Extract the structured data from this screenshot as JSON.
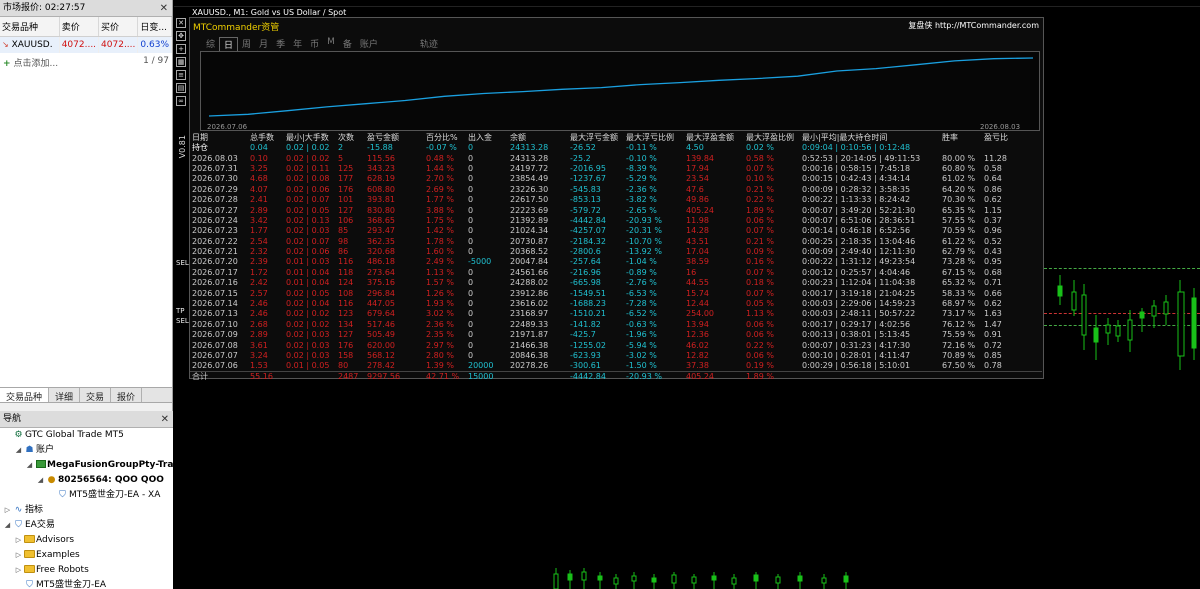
{
  "market_watch": {
    "title": "市场报价: 02:27:57",
    "columns": [
      "交易品种",
      "卖价",
      "买价",
      "日变..."
    ],
    "symbol": {
      "name": "XAUUSD.",
      "bid": "4072....",
      "ask": "4072....",
      "change": "0.63%"
    },
    "add_label": "点击添加...",
    "count": "1 / 97",
    "tabs": [
      "交易品种",
      "详细",
      "交易",
      "报价"
    ]
  },
  "navigator": {
    "title": "导航",
    "items": [
      {
        "label": "GTC Global Trade MT5",
        "level": 0,
        "icon": "gtc-icon",
        "bold": false
      },
      {
        "label": "账户",
        "level": 1,
        "icon": "accounts-icon",
        "bold": false
      },
      {
        "label": "MegaFusionGroupPty-Trad",
        "level": 2,
        "icon": "server-icon",
        "bold": true
      },
      {
        "label": "80256564: QOO QOO",
        "level": 3,
        "icon": "user-icon",
        "bold": true
      },
      {
        "label": "MT5盛世金刀-EA - XA",
        "level": 4,
        "icon": "ea-icon",
        "bold": false
      },
      {
        "label": "指标",
        "level": 0,
        "icon": "indicators-icon",
        "bold": false
      },
      {
        "label": "EA交易",
        "level": 0,
        "icon": "ea-icon",
        "bold": false
      },
      {
        "label": "Advisors",
        "level": 1,
        "icon": "folder-icon",
        "bold": false
      },
      {
        "label": "Examples",
        "level": 1,
        "icon": "folder-icon",
        "bold": false
      },
      {
        "label": "Free Robots",
        "level": 1,
        "icon": "folder-icon",
        "bold": false
      },
      {
        "label": "MT5盛世金刀-EA",
        "level": 1,
        "icon": "ea-icon",
        "bold": false
      }
    ]
  },
  "chart": {
    "title": "XAUUSD., M1:  Gold vs US Dollar / Spot",
    "side_label": "V0.81",
    "sel_labels": [
      "SEL",
      "TP",
      "SEL"
    ]
  },
  "mtc": {
    "title": "MTCommander资管",
    "site": "复盘侠 http://MTCommander.com",
    "tabs": [
      "综",
      "日",
      "周",
      "月",
      "季",
      "年",
      "币",
      "M",
      "备",
      "账户",
      "轨迹"
    ],
    "active_tab": "日",
    "equity": {
      "start_date": "2026.07.06",
      "end_date": "2026.08.03",
      "values": [
        20278,
        20847,
        21466,
        21972,
        22489,
        23169,
        23616,
        24288,
        24562,
        20048,
        20368,
        20731,
        21024,
        21393,
        22224,
        22618,
        23226,
        23854,
        24197,
        24313,
        24313
      ],
      "line_color": "#1aa0e0"
    },
    "columns": [
      "日期",
      "总手数",
      "最小|大手数",
      "次数",
      "盈亏金额",
      "百分比%",
      "出入金",
      "余额",
      "最大浮亏金额",
      "最大浮亏比例",
      "最大浮盈金额",
      "最大浮盈比例",
      "最小|平均|最大持仓时间",
      "胜率",
      "盈亏比"
    ],
    "holding": [
      "持仓",
      "0.04",
      "0.02 | 0.02",
      "2",
      "-15.88",
      "-0.07 %",
      "0",
      "24313.28",
      "-26.52",
      "-0.11 %",
      "4.50",
      "0.02 %",
      "0:09:04 | 0:10:56 | 0:12:48",
      "",
      ""
    ],
    "rows": [
      [
        "2026.08.03",
        "0.10",
        "0.02 | 0.02",
        "5",
        "115.56",
        "0.48 %",
        "0",
        "24313.28",
        "-25.2",
        "-0.10 %",
        "139.84",
        "0.58 %",
        "0:52:53 | 20:14:05 | 49:11:53",
        "80.00 %",
        "11.28"
      ],
      [
        "2026.07.31",
        "3.25",
        "0.02 | 0.11",
        "125",
        "343.23",
        "1.44 %",
        "0",
        "24197.72",
        "-2016.95",
        "-8.39 %",
        "17.94",
        "0.07 %",
        "0:00:16 | 0:58:15 | 7:45:18",
        "60.80 %",
        "0.58"
      ],
      [
        "2026.07.30",
        "4.68",
        "0.02 | 0.08",
        "177",
        "628.19",
        "2.70 %",
        "0",
        "23854.49",
        "-1237.67",
        "-5.29 %",
        "23.54",
        "0.10 %",
        "0:00:15 | 0:42:43 | 4:34:14",
        "61.02 %",
        "0.64"
      ],
      [
        "2026.07.29",
        "4.07",
        "0.02 | 0.06",
        "176",
        "608.80",
        "2.69 %",
        "0",
        "23226.30",
        "-545.83",
        "-2.36 %",
        "47.6",
        "0.21 %",
        "0:00:09 | 0:28:32 | 3:58:35",
        "64.20 %",
        "0.86"
      ],
      [
        "2026.07.28",
        "2.41",
        "0.02 | 0.07",
        "101",
        "393.81",
        "1.77 %",
        "0",
        "22617.50",
        "-853.13",
        "-3.82 %",
        "49.86",
        "0.22 %",
        "0:00:22 | 1:13:33 | 8:24:42",
        "70.30 %",
        "0.62"
      ],
      [
        "2026.07.27",
        "2.89",
        "0.02 | 0.05",
        "127",
        "830.80",
        "3.88 %",
        "0",
        "22223.69",
        "-579.72",
        "-2.65 %",
        "405.24",
        "1.89 %",
        "0:00:07 | 3:49:20 | 52:21:30",
        "65.35 %",
        "1.15"
      ],
      [
        "2026.07.24",
        "3.42",
        "0.02 | 0.13",
        "106",
        "368.65",
        "1.75 %",
        "0",
        "21392.89",
        "-4442.84",
        "-20.93 %",
        "11.98",
        "0.06 %",
        "0:00:07 | 6:51:06 | 28:36:51",
        "57.55 %",
        "0.37"
      ],
      [
        "2026.07.23",
        "1.77",
        "0.02 | 0.03",
        "85",
        "293.47",
        "1.42 %",
        "0",
        "21024.34",
        "-4257.07",
        "-20.31 %",
        "14.28",
        "0.07 %",
        "0:00:14 | 0:46:18 | 6:52:56",
        "70.59 %",
        "0.96"
      ],
      [
        "2026.07.22",
        "2.54",
        "0.02 | 0.07",
        "98",
        "362.35",
        "1.78 %",
        "0",
        "20730.87",
        "-2184.32",
        "-10.70 %",
        "43.51",
        "0.21 %",
        "0:00:25 | 2:18:35 | 13:04:46",
        "61.22 %",
        "0.52"
      ],
      [
        "2026.07.21",
        "2.32",
        "0.02 | 0.06",
        "86",
        "320.68",
        "1.60 %",
        "0",
        "20368.52",
        "-2800.6",
        "-13.92 %",
        "17.04",
        "0.09 %",
        "0:00:09 | 2:49:40 | 12:11:30",
        "62.79 %",
        "0.43"
      ],
      [
        "2026.07.20",
        "2.39",
        "0.01 | 0.03",
        "116",
        "486.18",
        "2.49 %",
        "-5000",
        "20047.84",
        "-257.64",
        "-1.04 %",
        "38.59",
        "0.16 %",
        "0:00:22 | 1:31:12 | 49:23:54",
        "73.28 %",
        "0.95"
      ],
      [
        "2026.07.17",
        "1.72",
        "0.01 | 0.04",
        "118",
        "273.64",
        "1.13 %",
        "0",
        "24561.66",
        "-216.96",
        "-0.89 %",
        "16",
        "0.07 %",
        "0:00:12 | 0:25:57 | 4:04:46",
        "67.15 %",
        "0.68"
      ],
      [
        "2026.07.16",
        "2.42",
        "0.01 | 0.04",
        "124",
        "375.16",
        "1.57 %",
        "0",
        "24288.02",
        "-665.98",
        "-2.76 %",
        "44.55",
        "0.18 %",
        "0:00:23 | 1:12:04 | 11:04:38",
        "65.32 %",
        "0.71"
      ],
      [
        "2026.07.15",
        "2.57",
        "0.02 | 0.05",
        "108",
        "296.84",
        "1.26 %",
        "0",
        "23912.86",
        "-1549.51",
        "-6.53 %",
        "15.74",
        "0.07 %",
        "0:00:17 | 3:19:18 | 21:04:25",
        "58.33 %",
        "0.66"
      ],
      [
        "2026.07.14",
        "2.46",
        "0.02 | 0.04",
        "116",
        "447.05",
        "1.93 %",
        "0",
        "23616.02",
        "-1688.23",
        "-7.28 %",
        "12.44",
        "0.05 %",
        "0:00:03 | 2:29:06 | 14:59:23",
        "68.97 %",
        "0.62"
      ],
      [
        "2026.07.13",
        "2.46",
        "0.02 | 0.02",
        "123",
        "679.64",
        "3.02 %",
        "0",
        "23168.97",
        "-1510.21",
        "-6.52 %",
        "254.00",
        "1.13 %",
        "0:00:03 | 2:48:11 | 50:57:22",
        "73.17 %",
        "1.63"
      ],
      [
        "2026.07.10",
        "2.68",
        "0.02 | 0.02",
        "134",
        "517.46",
        "2.36 %",
        "0",
        "22489.33",
        "-141.82",
        "-0.63 %",
        "13.94",
        "0.06 %",
        "0:00:17 | 0:29:17 | 4:02:56",
        "76.12 %",
        "1.47"
      ],
      [
        "2026.07.09",
        "2.89",
        "0.02 | 0.03",
        "127",
        "505.49",
        "2.35 %",
        "0",
        "21971.87",
        "-425.7",
        "-1.96 %",
        "12.36",
        "0.06 %",
        "0:00:13 | 0:38:01 | 5:13:45",
        "75.59 %",
        "0.91"
      ],
      [
        "2026.07.08",
        "3.61",
        "0.02 | 0.03",
        "176",
        "620.00",
        "2.97 %",
        "0",
        "21466.38",
        "-1255.02",
        "-5.94 %",
        "46.02",
        "0.22 %",
        "0:00:07 | 0:31:23 | 4:17:30",
        "72.16 %",
        "0.72"
      ],
      [
        "2026.07.07",
        "3.24",
        "0.02 | 0.03",
        "158",
        "568.12",
        "2.80 %",
        "0",
        "20846.38",
        "-623.93",
        "-3.02 %",
        "12.82",
        "0.06 %",
        "0:00:10 | 0:28:01 | 4:11:47",
        "70.89 %",
        "0.85"
      ],
      [
        "2026.07.06",
        "1.53",
        "0.01 | 0.05",
        "80",
        "278.42",
        "1.39 %",
        "20000",
        "20278.26",
        "-300.61",
        "-1.50 %",
        "37.38",
        "0.19 %",
        "0:00:29 | 0:56:18 | 5:10:01",
        "67.50 %",
        "0.78"
      ]
    ],
    "total": [
      "合计",
      "55.16",
      "",
      "2487",
      "9297.56",
      "42.71 %",
      "15000",
      "",
      "-4442.84",
      "-20.93 %",
      "405.24",
      "1.89 %",
      "",
      "",
      ""
    ]
  }
}
